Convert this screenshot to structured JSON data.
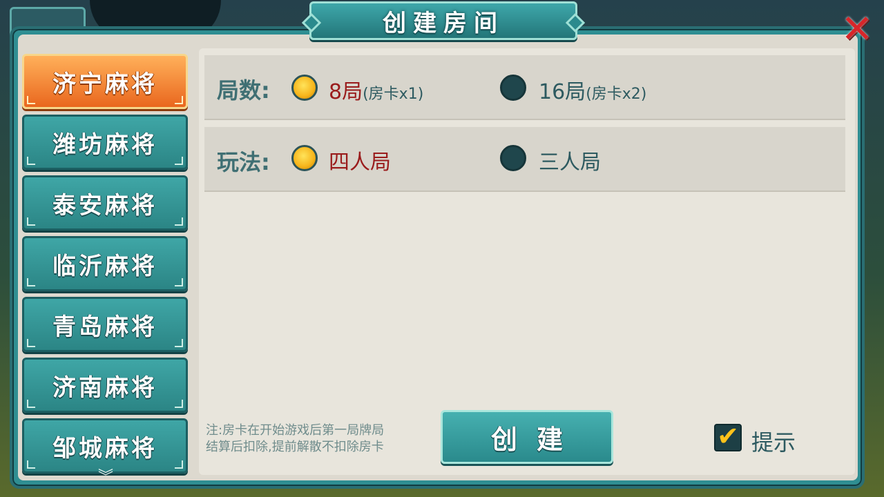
{
  "dialog": {
    "title": "创建房间",
    "close_icon": "close-icon"
  },
  "sidebar": {
    "items": [
      {
        "label": "济宁麻将",
        "active": true
      },
      {
        "label": "潍坊麻将",
        "active": false
      },
      {
        "label": "泰安麻将",
        "active": false
      },
      {
        "label": "临沂麻将",
        "active": false
      },
      {
        "label": "青岛麻将",
        "active": false
      },
      {
        "label": "济南麻将",
        "active": false
      },
      {
        "label": "邹城麻将",
        "active": false
      }
    ],
    "scroll_icon": "chevron-down-icon"
  },
  "options": {
    "rounds": {
      "label": "局数:",
      "choices": [
        {
          "main": "8局",
          "sub": "(房卡x1)",
          "selected": true
        },
        {
          "main": "16局",
          "sub": "(房卡x2)",
          "selected": false
        }
      ]
    },
    "mode": {
      "label": "玩法:",
      "choices": [
        {
          "main": "四人局",
          "selected": true
        },
        {
          "main": "三人局",
          "selected": false
        }
      ]
    }
  },
  "footer": {
    "note_line1": "注:房卡在开始游戏后第一局牌局",
    "note_line2": "结算后扣除,提前解散不扣除房卡",
    "create_label": "创建",
    "hint_label": "提示",
    "hint_checked": true
  },
  "colors": {
    "accent_teal": "#2f8e92",
    "active_orange": "#e9671e",
    "selected_text": "#9a1c1c",
    "radio_on": "#f6b41a",
    "close_red": "#d8262a"
  }
}
